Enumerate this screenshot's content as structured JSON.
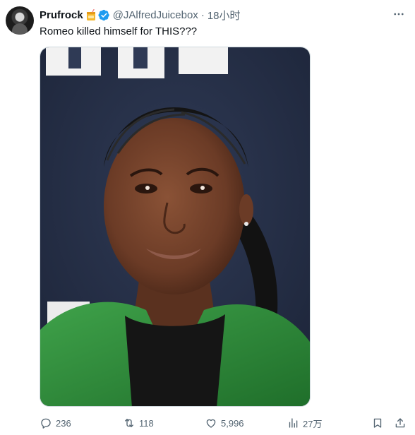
{
  "tweet": {
    "author": {
      "display_name": "Prufrock",
      "handle": "@JAlfredJuicebox",
      "badge_emoji_icon": "juice-box-emoji-icon",
      "verified_icon": "verified-badge-icon"
    },
    "separator": "·",
    "time": "18小时",
    "text": "Romeo killed himself for THIS???",
    "media": {
      "type": "photo",
      "icon": "photo-icon"
    },
    "actions": {
      "reply_count": "236",
      "retweet_count": "118",
      "like_count": "5,996",
      "views_count": "27万"
    }
  },
  "colors": {
    "text_primary": "#0f1419",
    "text_secondary": "#536471",
    "verified_blue": "#1d9bf0",
    "border": "#cfd9de"
  }
}
